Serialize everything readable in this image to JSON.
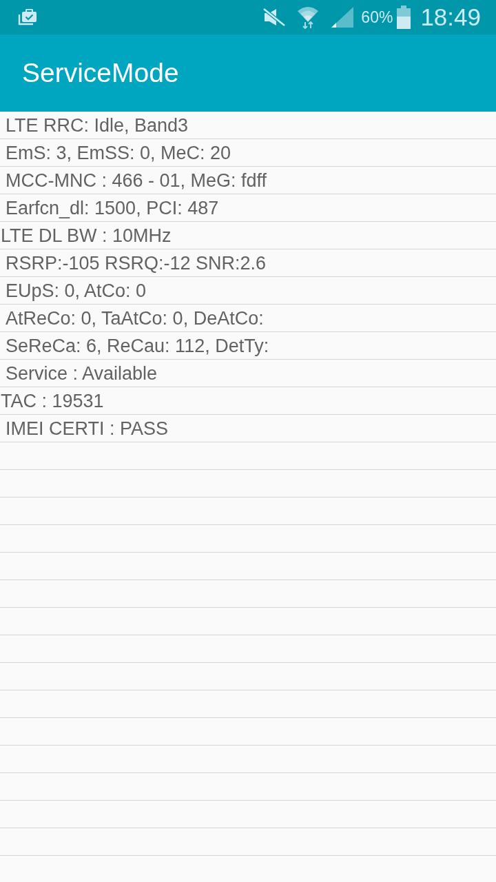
{
  "status_bar": {
    "battery_percent": "60%",
    "time": "18:49"
  },
  "app_bar": {
    "title": "ServiceMode"
  },
  "rows": [
    {
      "text": "LTE RRC: Idle, Band3",
      "indented": true
    },
    {
      "text": "EmS: 3, EmSS: 0, MeC: 20",
      "indented": true
    },
    {
      "text": "MCC-MNC : 466 - 01, MeG: fdff",
      "indented": true
    },
    {
      "text": "Earfcn_dl: 1500, PCI: 487",
      "indented": true
    },
    {
      "text": "LTE DL BW : 10MHz",
      "indented": false
    },
    {
      "text": "RSRP:-105 RSRQ:-12 SNR:2.6",
      "indented": true
    },
    {
      "text": "EUpS: 0, AtCo: 0",
      "indented": true
    },
    {
      "text": "AtReCo: 0, TaAtCo: 0, DeAtCo:",
      "indented": true
    },
    {
      "text": "SeReCa: 6, ReCau: 112, DetTy:",
      "indented": true
    },
    {
      "text": "Service : Available",
      "indented": true
    },
    {
      "text": "TAC : 19531",
      "indented": false
    },
    {
      "text": "IMEI CERTI : PASS",
      "indented": true
    }
  ]
}
